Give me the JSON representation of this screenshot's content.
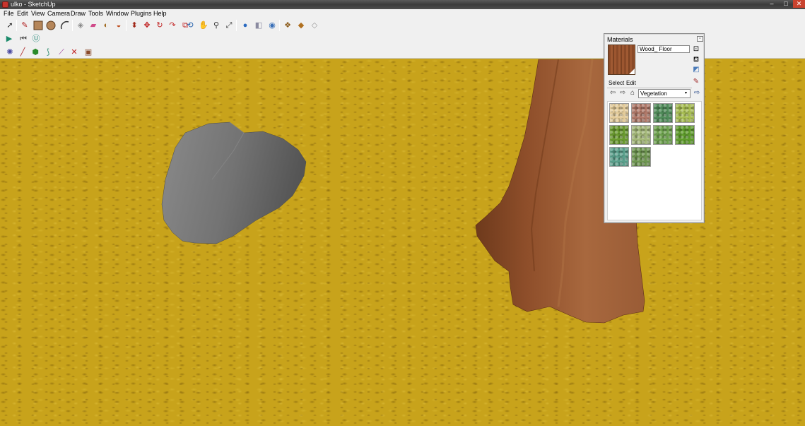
{
  "window": {
    "title": "ulko - SketchUp",
    "min_glyph": "–",
    "max_glyph": "□",
    "close_glyph": "✕"
  },
  "menu": [
    "File",
    "Edit",
    "View",
    "Camera",
    "Draw",
    "Tools",
    "Window",
    "Plugins",
    "Help"
  ],
  "materials": {
    "title": "Materials",
    "close_glyph": "▫",
    "current_material": "Wood_ Floor",
    "tabs": {
      "select": "Select",
      "edit": "Edit"
    },
    "library": "Vegetation",
    "library_arrow": "▾",
    "swatch_colors": [
      "#e4cc9a",
      "#b07868",
      "#4f8c59",
      "#a8be52",
      "#6a9a2e",
      "#a4b878",
      "#6da24e",
      "#5e9c2a",
      "#5aa08c",
      "#6e9650"
    ]
  },
  "colors": {
    "ground": "#c8a31b",
    "tree": "#9c5a35",
    "rock": "#6e6e6e",
    "titlebar": "#444444",
    "chrome": "#f0f0f0"
  }
}
